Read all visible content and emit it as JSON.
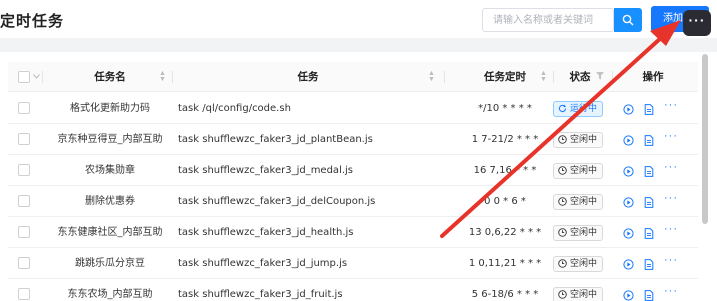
{
  "header": {
    "title": "定时任务",
    "search_placeholder": "请输入名称或者关键词",
    "add_button": "添加任务",
    "more_label": "···"
  },
  "table": {
    "columns": {
      "name": "任务名",
      "command": "任务",
      "schedule": "任务定时",
      "status": "状态",
      "actions": "操作"
    },
    "rows": [
      {
        "name": "格式化更新助力码",
        "command": "task /ql/config/code.sh",
        "schedule": "*/10 * * * *",
        "status": "运行中",
        "state": "running"
      },
      {
        "name": "京东种豆得豆_内部互助",
        "command": "task shufflewzc_faker3_jd_plantBean.js",
        "schedule": "1 7-21/2 * * *",
        "status": "空闲中",
        "state": "idle"
      },
      {
        "name": "农场集勋章",
        "command": "task shufflewzc_faker3_jd_medal.js",
        "schedule": "16 7,16 * * *",
        "status": "空闲中",
        "state": "idle"
      },
      {
        "name": "删除优惠券",
        "command": "task shufflewzc_faker3_jd_delCoupon.js",
        "schedule": "0 0 * 6 *",
        "status": "空闲中",
        "state": "idle"
      },
      {
        "name": "东东健康社区_内部互助",
        "command": "task shufflewzc_faker3_jd_health.js",
        "schedule": "13 0,6,22 * * *",
        "status": "空闲中",
        "state": "idle"
      },
      {
        "name": "跳跳乐瓜分京豆",
        "command": "task shufflewzc_faker3_jd_jump.js",
        "schedule": "1 0,11,21 * * *",
        "status": "空闲中",
        "state": "idle"
      },
      {
        "name": "东东农场_内部互助",
        "command": "task shufflewzc_faker3_jd_fruit.js",
        "schedule": "5 6-18/6 * * *",
        "status": "空闲中",
        "state": "idle"
      }
    ]
  },
  "colors": {
    "primary": "#1677ff",
    "annotation_arrow": "#e8332a"
  }
}
